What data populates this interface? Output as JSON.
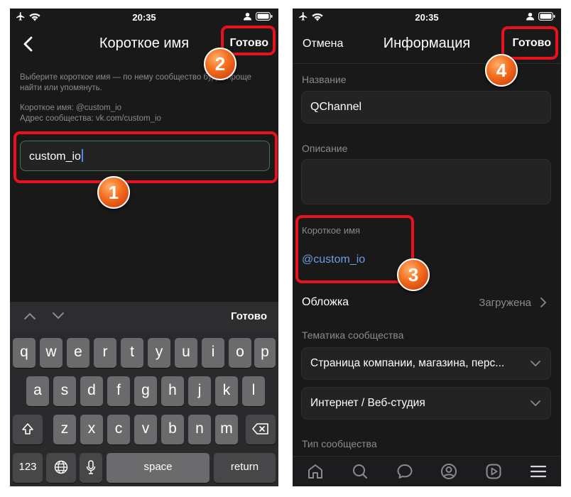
{
  "status_bar": {
    "time": "20:35"
  },
  "left": {
    "title": "Короткое имя",
    "done_label": "Готово",
    "hint": "Выберите короткое имя — по нему сообщество будет проще найти или упомянуть.",
    "short_name_line": "Короткое имя: @custom_io",
    "address_line": "Адрес сообщества: vk.com/custom_io",
    "input_value": "custom_io",
    "keyboard": {
      "done_label": "Готово",
      "row1": [
        "q",
        "w",
        "e",
        "r",
        "t",
        "y",
        "u",
        "i",
        "o",
        "p"
      ],
      "row2": [
        "a",
        "s",
        "d",
        "f",
        "g",
        "h",
        "j",
        "k",
        "l"
      ],
      "row3": [
        "z",
        "x",
        "c",
        "v",
        "b",
        "n",
        "m"
      ],
      "numbers_label": "123",
      "space_label": "space",
      "return_label": "return"
    }
  },
  "right": {
    "cancel_label": "Отмена",
    "title": "Информация",
    "done_label": "Готово",
    "name_label": "Название",
    "name_value": "QChannel",
    "description_label": "Описание",
    "description_value": "",
    "short_name_label": "Короткое имя",
    "short_name_value": "@custom_io",
    "cover_label": "Обложка",
    "cover_value": "Загружена",
    "theme_label": "Тематика сообщества",
    "theme_value": "Страница компании, магазина, перс...",
    "category_value": "Интернет / Веб-студия",
    "type_label": "Тип сообщества"
  },
  "markers": [
    "1",
    "2",
    "3",
    "4"
  ],
  "colors": {
    "highlight": "#e8111d",
    "marker": "#f36b1c",
    "link": "#6d9ee0",
    "background": "#19191a"
  },
  "icons": {
    "tabbar": [
      "home-icon",
      "search-icon",
      "chat-icon",
      "profile-icon",
      "video-icon",
      "menu-icon"
    ]
  }
}
